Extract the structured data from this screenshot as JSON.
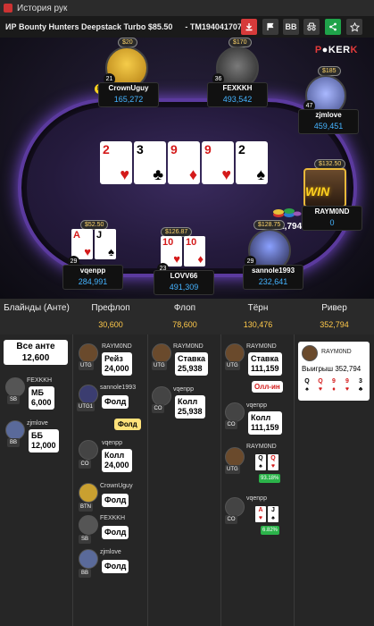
{
  "window": {
    "title": "История рук"
  },
  "header": {
    "game": "ИР  Bounty Hunters Deepstack Turbo $85.50",
    "hand_id": "- TM1940417071",
    "bb_label": "BB"
  },
  "logo": {
    "text_a": "P",
    "text_b": "KER",
    "text_c": "K"
  },
  "board": [
    {
      "rank": "2",
      "suit": "♥"
    },
    {
      "rank": "3",
      "suit": "♣"
    },
    {
      "rank": "9",
      "suit": "♦"
    },
    {
      "rank": "9",
      "suit": "♥"
    },
    {
      "rank": "2",
      "suit": "♠"
    }
  ],
  "pot": "352,794",
  "seats": [
    {
      "name": "CrownUguy",
      "stack": "165,272",
      "bounty": "$20",
      "level": "21",
      "dealer": "D"
    },
    {
      "name": "FEXKKH",
      "stack": "493,542",
      "bounty": "$170",
      "level": "36"
    },
    {
      "name": "zjmlove",
      "stack": "459,451",
      "bounty": "$185",
      "level": "47"
    },
    {
      "name": "RAYM0ND",
      "stack": "0",
      "bounty": "$132.50",
      "win_label": "WIN"
    },
    {
      "name": "sannole1993",
      "stack": "232,641",
      "bounty": "$128.75",
      "level": "29"
    },
    {
      "name": "LOVV66",
      "stack": "491,309",
      "bounty": "$126.87",
      "level": "23",
      "cards": [
        {
          "rank": "10",
          "suit": "♥"
        },
        {
          "rank": "10",
          "suit": "♦"
        }
      ]
    },
    {
      "name": "vqenpp",
      "stack": "284,991",
      "bounty": "$52.50",
      "level": "29",
      "cards": [
        {
          "rank": "A",
          "suit": "♥"
        },
        {
          "rank": "J",
          "suit": "♠"
        }
      ]
    }
  ],
  "streets": [
    {
      "title": "Блайнды (Анте)",
      "value": ""
    },
    {
      "title": "Префлоп",
      "value": "30,600"
    },
    {
      "title": "Флоп",
      "value": "78,600"
    },
    {
      "title": "Тёрн",
      "value": "130,476"
    },
    {
      "title": "Ривер",
      "value": "352,794"
    }
  ],
  "blinds": {
    "ante_label": "Все анте",
    "ante_value": "12,600",
    "sb": {
      "name": "FEXKKH",
      "pos": "SB",
      "action": "МБ",
      "amount": "6,000"
    },
    "bb": {
      "name": "zjmlove",
      "pos": "BB",
      "action": "ББ",
      "amount": "12,000"
    }
  },
  "preflop": [
    {
      "name": "RAYM0ND",
      "pos": "UTG",
      "action": "Рейз",
      "amount": "24,000"
    },
    {
      "name": "sannole1993",
      "pos": "UTG1",
      "action": "Фолд",
      "amount": ""
    },
    {
      "name": "LOVV66",
      "pos": "",
      "action": "Фолд",
      "amount": ""
    },
    {
      "name": "vqenpp",
      "pos": "CO",
      "action": "Колл",
      "amount": "24,000"
    },
    {
      "name": "CrownUguy",
      "pos": "BTN",
      "action": "Фолд",
      "amount": ""
    },
    {
      "name": "FEXKKH",
      "pos": "SB",
      "action": "Фолд",
      "amount": ""
    },
    {
      "name": "zjmlove",
      "pos": "BB",
      "action": "Фолд",
      "amount": ""
    }
  ],
  "flop": [
    {
      "name": "RAYM0ND",
      "pos": "UTG",
      "action": "Ставка",
      "amount": "25,938"
    },
    {
      "name": "vqenpp",
      "pos": "CO",
      "action": "Колл",
      "amount": "25,938"
    }
  ],
  "turn": [
    {
      "name": "RAYM0ND",
      "pos": "UTG",
      "action": "Ставка",
      "amount": "111,159"
    },
    {
      "allin": "Олл-ин"
    },
    {
      "name": "vqenpp",
      "pos": "CO",
      "action": "Колл",
      "amount": "111,159"
    },
    {
      "name": "RAYM0ND",
      "pos": "UTG",
      "equity": "93.18%",
      "cards": [
        {
          "rank": "Q",
          "suit": "♠"
        },
        {
          "rank": "Q",
          "suit": "♥"
        }
      ]
    },
    {
      "name": "vqenpp",
      "pos": "CO",
      "equity": "6.82%",
      "cards": [
        {
          "rank": "A",
          "suit": "♥"
        },
        {
          "rank": "J",
          "suit": "♠"
        }
      ]
    }
  ],
  "river": {
    "name": "RAYM0ND",
    "label": "Выигрыш 352,794",
    "cards": [
      {
        "rank": "Q",
        "suit": "♠"
      },
      {
        "rank": "Q",
        "suit": "♥"
      },
      {
        "rank": "9",
        "suit": "♦"
      },
      {
        "rank": "9",
        "suit": "♥"
      },
      {
        "rank": "3",
        "suit": "♣"
      }
    ]
  }
}
